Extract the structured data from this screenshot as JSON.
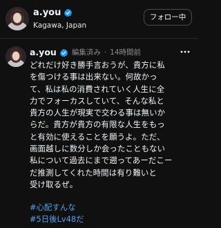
{
  "profile": {
    "username": "a.you",
    "location": "Kagawa, Japan",
    "follow_label": "フォロー中",
    "verified_color": "#1d9bf0",
    "icons": [
      "avatar",
      "verified-icon"
    ]
  },
  "post": {
    "username": "a.you",
    "edited_label": "編集済み",
    "separator": "·",
    "time_ago": "14時間前",
    "body_lines": [
      "どれだけ好き勝手言おうが、貴方に私",
      "を傷つける事は出来ない。何故かっ",
      "て、私は私の消費されていく人生に全",
      "力でフォーカスしていて、そんな私と",
      "貴方の人生が現実で交わる事は無いか",
      "らだ。貴方が貴方の有限な人生をもっ",
      "と有効に使えることを願うよ。ただ、",
      "画面越しに数分しか会ったこともない",
      "私について過去にまで遡ってあーだこー",
      "だ推測してくれた時間は有り難いと",
      "受け取るぜ。"
    ],
    "hashtags": [
      "#心配すんな",
      "#5日後Lv48だ"
    ],
    "hashtag_color": "#5b9fe8",
    "icons": [
      "avatar",
      "verified-icon",
      "more-icon"
    ]
  }
}
